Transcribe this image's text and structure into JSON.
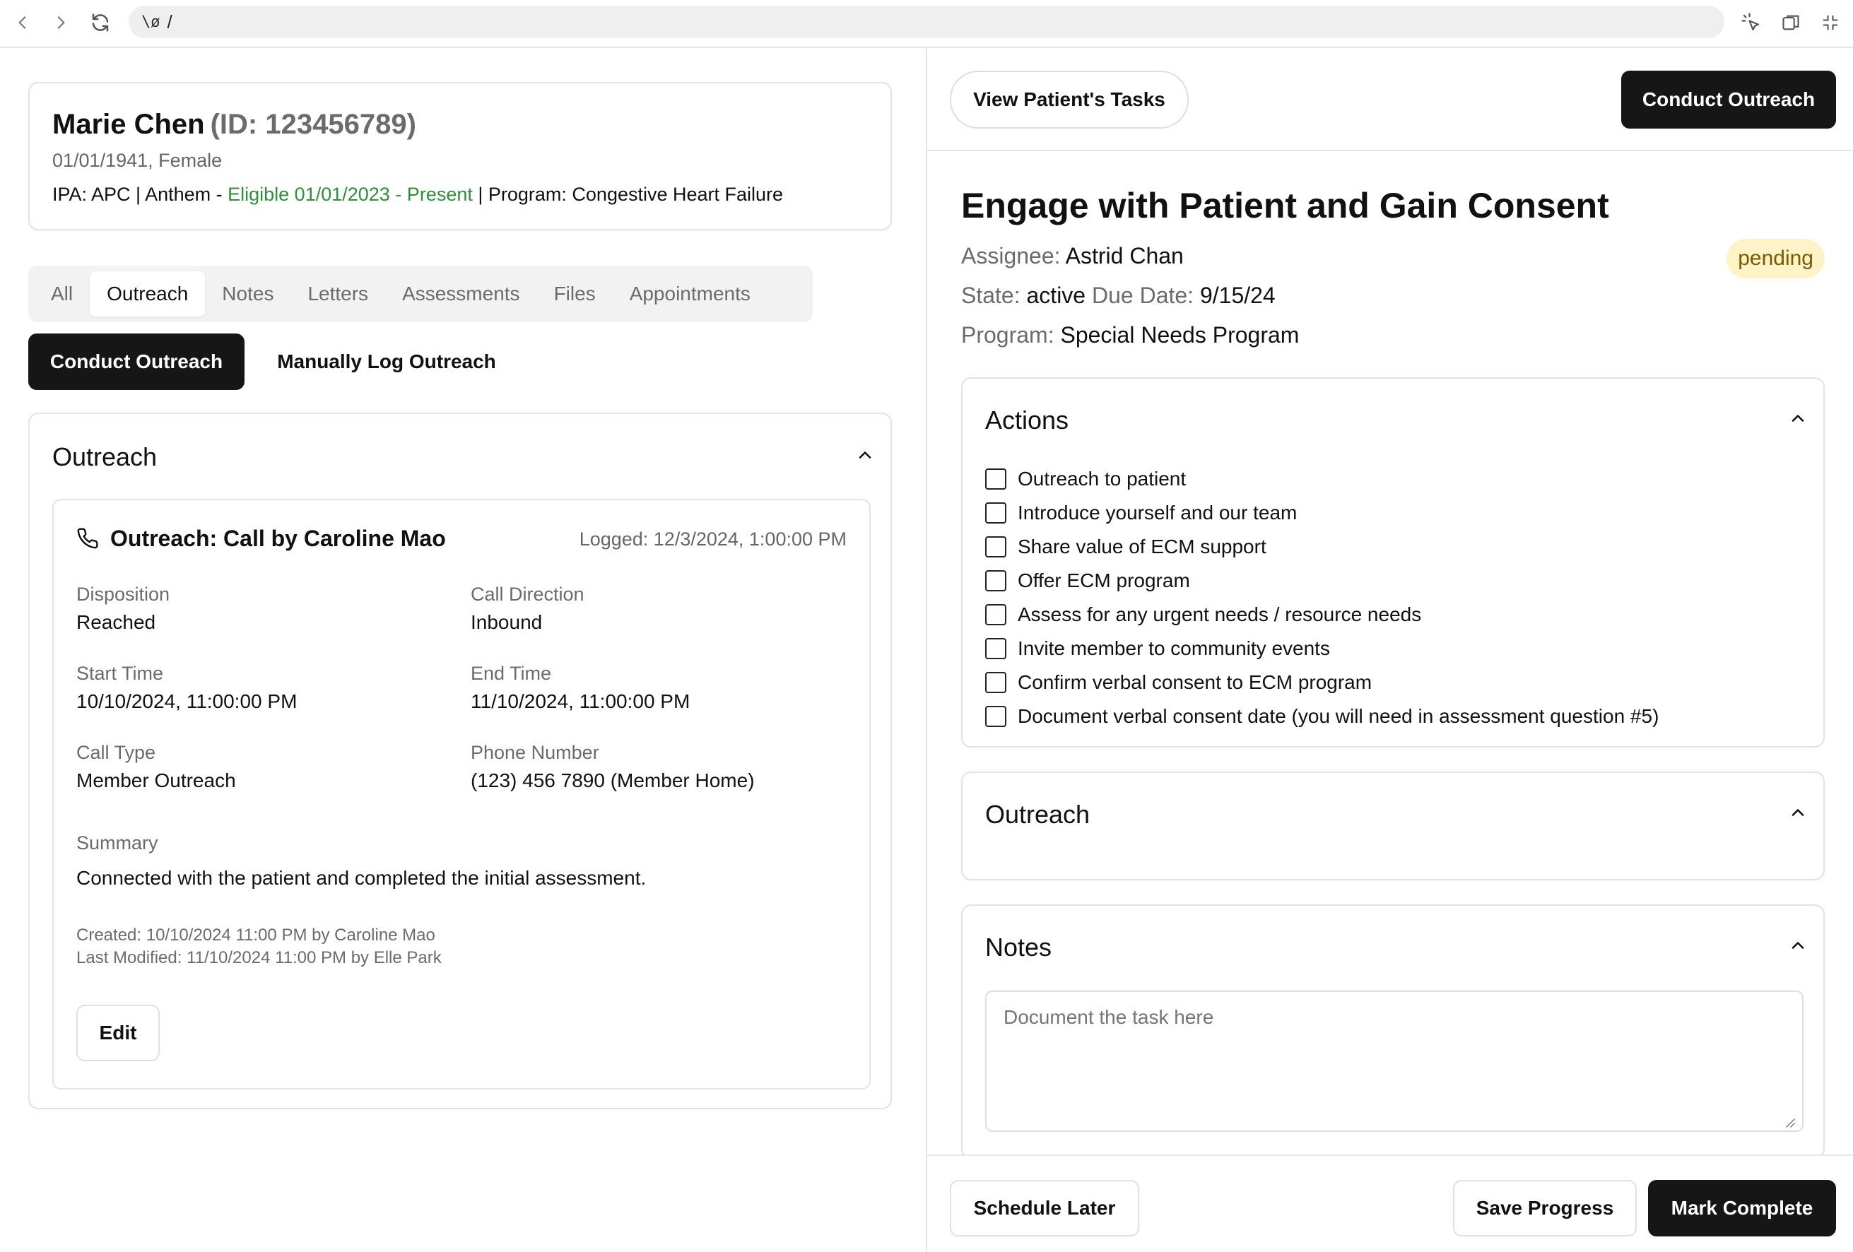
{
  "browser": {
    "url_prefix": "\\ø",
    "url": "/"
  },
  "patient": {
    "name": "Marie Chen",
    "id_text": "(ID: 123456789)",
    "dob_gender": "01/01/1941, Female",
    "ipa_prefix": "IPA: APC | Anthem - ",
    "eligibility": "Eligible 01/01/2023 - Present",
    "program_suffix": " | Program: Congestive Heart Failure"
  },
  "tabs": [
    {
      "label": "All"
    },
    {
      "label": "Outreach"
    },
    {
      "label": "Notes"
    },
    {
      "label": "Letters"
    },
    {
      "label": "Assessments"
    },
    {
      "label": "Files"
    },
    {
      "label": "Appointments"
    }
  ],
  "left_actions": {
    "conduct_outreach": "Conduct Outreach",
    "manual_log": "Manually Log Outreach"
  },
  "outreach_section": {
    "title": "Outreach",
    "card": {
      "title": "Outreach: Call by Caroline Mao",
      "logged": "Logged: 12/3/2024, 1:00:00 PM",
      "fields": {
        "disposition_label": "Disposition",
        "disposition_value": "Reached",
        "call_direction_label": "Call Direction",
        "call_direction_value": "Inbound",
        "start_time_label": "Start Time",
        "start_time_value": "10/10/2024, 11:00:00 PM",
        "end_time_label": "End Time",
        "end_time_value": "11/10/2024, 11:00:00 PM",
        "call_type_label": "Call Type",
        "call_type_value": "Member Outreach",
        "phone_label": "Phone Number",
        "phone_value": "(123) 456 7890 (Member Home)",
        "summary_label": "Summary",
        "summary_value": "Connected with the patient and completed the initial assessment."
      },
      "created": "Created: 10/10/2024 11:00 PM by Caroline Mao",
      "modified": "Last Modified: 11/10/2024 11:00 PM by Elle Park",
      "edit_label": "Edit"
    }
  },
  "task": {
    "view_tasks_label": "View Patient's Tasks",
    "conduct_outreach_label": "Conduct Outreach",
    "title": "Engage with Patient and Gain Consent",
    "assignee_key": "Assignee:",
    "assignee_value": "Astrid Chan",
    "status": "pending",
    "state_key": "State:",
    "state_value": "active",
    "due_key": "Due Date:",
    "due_value": "9/15/24",
    "program_key": "Program:",
    "program_value": "Special Needs Program",
    "actions_title": "Actions",
    "actions": [
      "Outreach to patient",
      "Introduce yourself and our team",
      "Share value of ECM support",
      "Offer ECM program",
      "Assess for any urgent needs / resource needs",
      "Invite member to community events",
      "Confirm verbal consent to ECM program",
      "Document verbal consent date (you will need in assessment question #5)"
    ],
    "outreach_title": "Outreach",
    "notes_title": "Notes",
    "notes_placeholder": "Document the task here",
    "schedule_later": "Schedule Later",
    "save_progress": "Save Progress",
    "mark_complete": "Mark Complete"
  },
  "colors": {
    "eligible_green": "#2f8f3a",
    "dark_button": "#161616",
    "pending_badge_bg": "#fdf3c6"
  },
  "icons": [
    "back-icon",
    "forward-icon",
    "reload-icon",
    "cursor-select-icon",
    "window-icon",
    "minimize-icon",
    "phone-icon",
    "chevron-up-icon"
  ]
}
